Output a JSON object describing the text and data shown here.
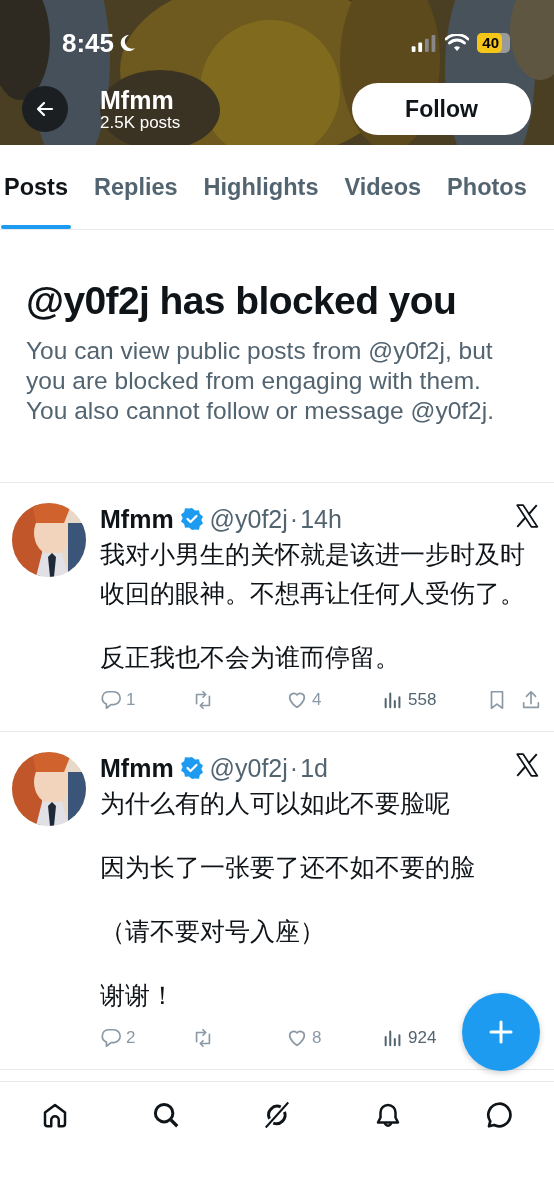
{
  "status_bar": {
    "time": "8:45",
    "battery": "40"
  },
  "header": {
    "name": "Mfmm",
    "posts": "2.5K posts",
    "follow_button": "Follow"
  },
  "tabs": [
    {
      "label": "Posts",
      "selected": true
    },
    {
      "label": "Replies",
      "selected": false
    },
    {
      "label": "Highlights",
      "selected": false
    },
    {
      "label": "Videos",
      "selected": false
    },
    {
      "label": "Photos",
      "selected": false
    }
  ],
  "blocked_notice": {
    "title": "@y0f2j has blocked you",
    "message": "You can view public posts from @y0f2j, but you are blocked from engaging with them. You also cannot follow or message @y0f2j."
  },
  "posts": [
    {
      "name": "Mfmm",
      "verified": true,
      "handle": "@y0f2j",
      "separator": "·",
      "time": "14h",
      "paragraphs": [
        "我对小男生的关怀就是该进一步时及时收回的眼神。不想再让任何人受伤了。",
        "反正我也不会为谁而停留。"
      ],
      "actions": [
        {
          "kind": "reply",
          "count": "1"
        },
        {
          "kind": "repost"
        },
        {
          "kind": "like",
          "count": "4"
        },
        {
          "kind": "views",
          "count": "558"
        },
        {
          "kind": "bookmark"
        },
        {
          "kind": "share"
        }
      ]
    },
    {
      "name": "Mfmm",
      "verified": true,
      "handle": "@y0f2j",
      "separator": "·",
      "time": "1d",
      "paragraphs": [
        "为什么有的人可以如此不要脸呢",
        "因为长了一张要了还不如不要的脸",
        "（请不要对号入座）",
        "谢谢！"
      ],
      "actions": [
        {
          "kind": "reply",
          "count": "2"
        },
        {
          "kind": "repost"
        },
        {
          "kind": "like",
          "count": "8"
        },
        {
          "kind": "views",
          "count": "924"
        }
      ]
    }
  ],
  "nav": [
    {
      "kind": "home"
    },
    {
      "kind": "search"
    },
    {
      "kind": "grok"
    },
    {
      "kind": "notifications"
    },
    {
      "kind": "messages"
    }
  ]
}
